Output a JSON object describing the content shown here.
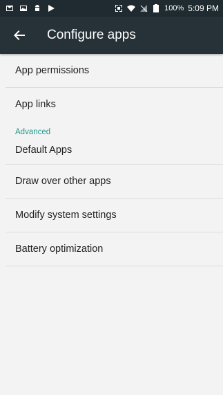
{
  "statusbar": {
    "battery_percent": "100%",
    "time": "5:09 PM"
  },
  "appbar": {
    "title": "Configure apps"
  },
  "list": {
    "items": [
      {
        "label": "App permissions"
      },
      {
        "label": "App links"
      }
    ],
    "advanced_header": "Advanced",
    "advanced_items": [
      {
        "label": "Default Apps"
      },
      {
        "label": "Draw over other apps"
      },
      {
        "label": "Modify system settings"
      },
      {
        "label": "Battery optimization"
      }
    ]
  },
  "colors": {
    "statusbar_bg": "#1f2b30",
    "appbar_bg": "#263238",
    "accent": "#1e9b8a",
    "page_bg": "#f3f3f3"
  }
}
